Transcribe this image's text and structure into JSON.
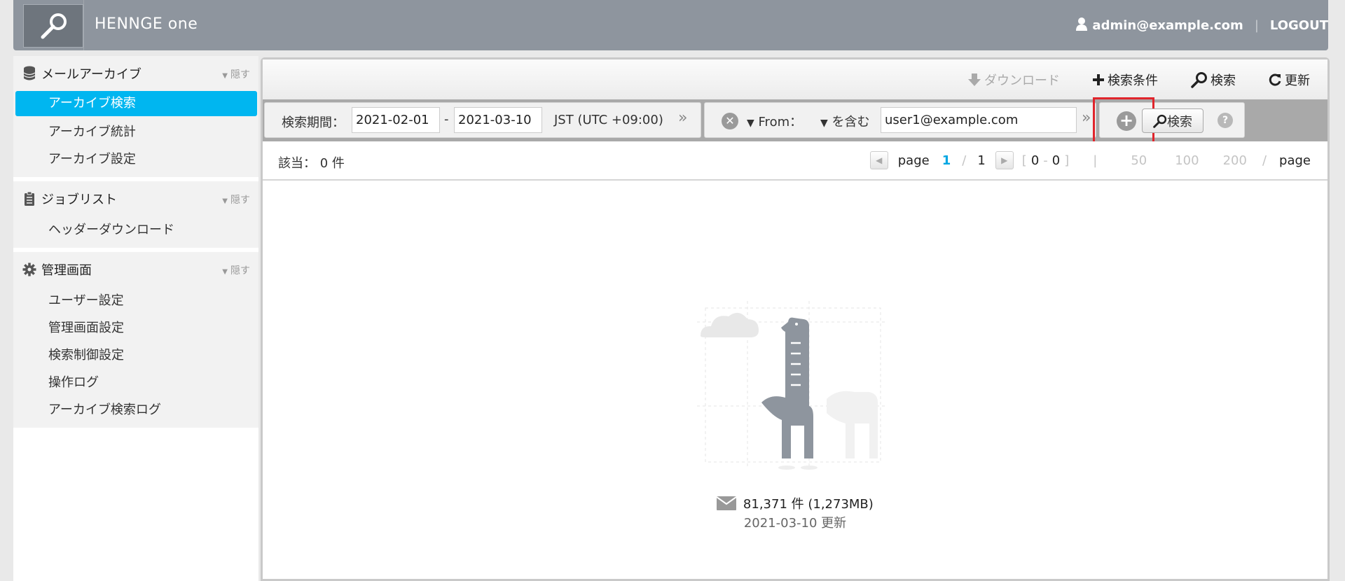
{
  "header": {
    "brand": "HENNGE one",
    "user_email": "admin@example.com",
    "separator": "|",
    "logout_label": "LOGOUT"
  },
  "sidebar": {
    "groups": [
      {
        "title": "メールアーカイブ",
        "icon": "database-icon",
        "hide_label": "隠す",
        "items": [
          {
            "label": "アーカイブ検索",
            "active": true
          },
          {
            "label": "アーカイブ統計"
          },
          {
            "label": "アーカイブ設定"
          }
        ]
      },
      {
        "title": "ジョブリスト",
        "icon": "clipboard-icon",
        "hide_label": "隠す",
        "items": [
          {
            "label": "ヘッダーダウンロード"
          }
        ]
      },
      {
        "title": "管理画面",
        "icon": "gear-icon",
        "hide_label": "隠す",
        "items": [
          {
            "label": "ユーザー設定"
          },
          {
            "label": "管理画面設定"
          },
          {
            "label": "検索制御設定"
          },
          {
            "label": "操作ログ"
          },
          {
            "label": "アーカイブ検索ログ"
          }
        ]
      }
    ]
  },
  "toolbar": {
    "download_label": "ダウンロード",
    "search_conditions_label": "検索条件",
    "search_label": "検索",
    "refresh_label": "更新"
  },
  "filter": {
    "period_label": "検索期間：",
    "date_from": "2021-02-01",
    "date_separator": "-",
    "date_to": "2021-03-10",
    "timezone": "JST (UTC +09:00)",
    "more_chevron": "»",
    "field_label": "From：",
    "operator_label": "を含む",
    "value": "user1@example.com",
    "search_button_label": "検索",
    "help_label": "?"
  },
  "results": {
    "hits_label": "該当：",
    "hits_count": "0 件",
    "page_word": "page",
    "current_page": "1",
    "page_slash": "/",
    "total_pages": "1",
    "range_open": "[",
    "range_start": "0",
    "range_dash": "-",
    "range_end": "0",
    "range_close": "]",
    "pipe": "|",
    "page_sizes": [
      "50",
      "100",
      "200"
    ],
    "per_page_slash": "/",
    "per_page_word": "page"
  },
  "archive_stats": {
    "count_text": "81,371 件 (1,273MB)",
    "updated_text": "2021-03-10 更新"
  },
  "colors": {
    "header_bg": "#8e959e",
    "active_item": "#00b6f0",
    "highlight": "#e0242b",
    "current_page": "#00a6e2"
  }
}
